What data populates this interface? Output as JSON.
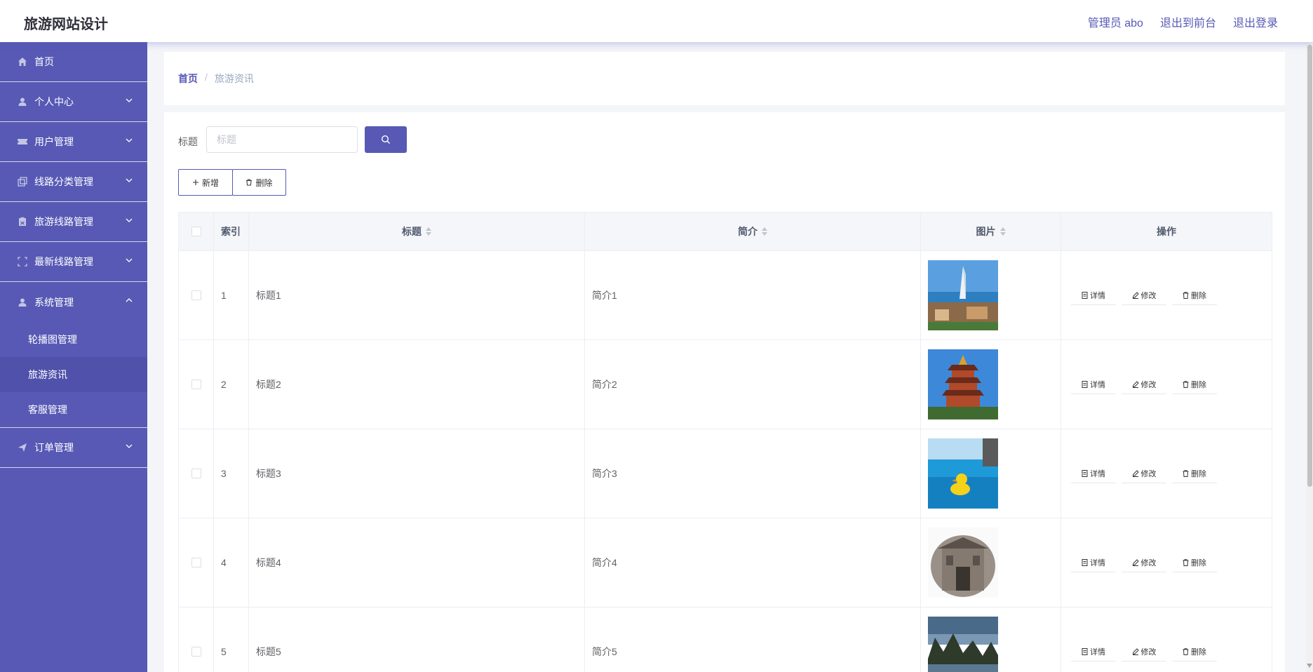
{
  "app": {
    "title": "旅游网站设计"
  },
  "header": {
    "admin": "管理员 abo",
    "to_front": "退出到前台",
    "logout": "退出登录"
  },
  "sidebar": {
    "items": [
      {
        "label": "首页",
        "icon": "home-icon"
      },
      {
        "label": "个人中心",
        "icon": "user-icon"
      },
      {
        "label": "用户管理",
        "icon": "ticket-icon"
      },
      {
        "label": "线路分类管理",
        "icon": "copy-icon"
      },
      {
        "label": "旅游线路管理",
        "icon": "clipboard-icon"
      },
      {
        "label": "最新线路管理",
        "icon": "frame-icon"
      },
      {
        "label": "系统管理",
        "icon": "user-icon"
      }
    ],
    "system_sub": [
      "轮播图管理",
      "旅游资讯",
      "客服管理"
    ],
    "order": {
      "label": "订单管理",
      "icon": "send-icon"
    }
  },
  "breadcrumb": {
    "home": "首页",
    "sep": "/",
    "current": "旅游资讯"
  },
  "search": {
    "label": "标题",
    "placeholder": "标题"
  },
  "actions": {
    "add": "新增",
    "delete": "删除"
  },
  "table": {
    "headers": {
      "index": "索引",
      "title": "标题",
      "intro": "简介",
      "image": "图片",
      "ops": "操作"
    },
    "ops": {
      "detail": "详情",
      "edit": "修改",
      "delete": "删除"
    },
    "rows": [
      {
        "index": "1",
        "title": "标题1",
        "intro": "简介1",
        "image": "burj-al-arab-resort"
      },
      {
        "index": "2",
        "title": "标题2",
        "intro": "简介2",
        "image": "yellow-crane-tower"
      },
      {
        "index": "3",
        "title": "标题3",
        "intro": "简介3",
        "image": "rubber-duck-pool"
      },
      {
        "index": "4",
        "title": "标题4",
        "intro": "简介4",
        "image": "stone-archway"
      },
      {
        "index": "5",
        "title": "标题5",
        "intro": "简介5",
        "image": "lake-karst-mountains"
      }
    ]
  },
  "colors": {
    "primary": "#5759b5",
    "sidebar_bg": "#5759b5",
    "active_sub": "#4f51ab"
  }
}
